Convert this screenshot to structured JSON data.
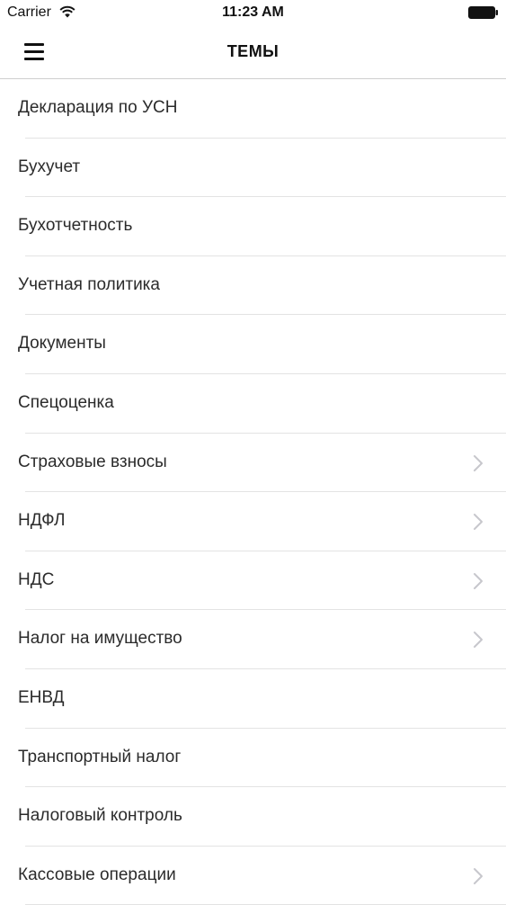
{
  "status_bar": {
    "carrier": "Carrier",
    "time": "11:23 AM",
    "wifi_icon": "wifi-icon",
    "battery_icon": "battery-icon"
  },
  "nav_bar": {
    "title": "ТЕМЫ",
    "menu_icon": "hamburger-menu-icon"
  },
  "colors": {
    "separator": "#e3e3e3",
    "chevron": "#c7c7cc",
    "text": "#2b2b2b"
  },
  "topics": [
    {
      "label": "Декларация по УСН",
      "has_chevron": false
    },
    {
      "label": "Бухучет",
      "has_chevron": false
    },
    {
      "label": "Бухотчетность",
      "has_chevron": false
    },
    {
      "label": "Учетная политика",
      "has_chevron": false
    },
    {
      "label": "Документы",
      "has_chevron": false
    },
    {
      "label": "Спецоценка",
      "has_chevron": false
    },
    {
      "label": "Страховые взносы",
      "has_chevron": true
    },
    {
      "label": "НДФЛ",
      "has_chevron": true
    },
    {
      "label": "НДС",
      "has_chevron": true
    },
    {
      "label": "Налог на имущество",
      "has_chevron": true
    },
    {
      "label": "ЕНВД",
      "has_chevron": false
    },
    {
      "label": "Транспортный налог",
      "has_chevron": false
    },
    {
      "label": "Налоговый контроль",
      "has_chevron": false
    },
    {
      "label": "Кассовые операции",
      "has_chevron": true
    }
  ]
}
